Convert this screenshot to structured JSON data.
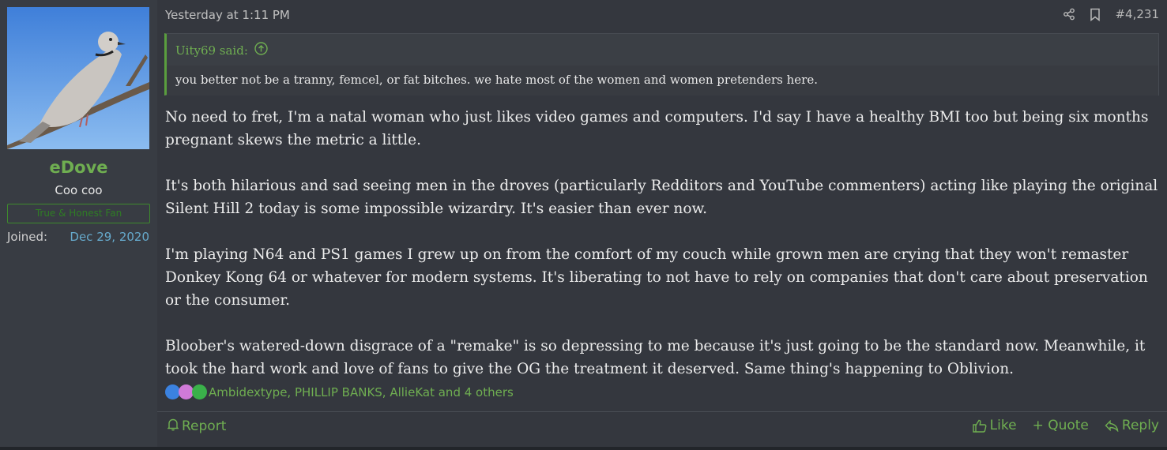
{
  "user": {
    "username": "eDove",
    "user_title": "Coo coo",
    "banner": "True & Honest Fan",
    "joined_label": "Joined:",
    "joined_value": "Dec 29, 2020"
  },
  "post": {
    "date": "Yesterday at 1:11 PM",
    "number": "#4,231",
    "quote": {
      "author": "Uity69 said:",
      "text": "you better not be a tranny, femcel, or fat bitches. we hate most of the women and women pretenders here."
    },
    "paragraphs": [
      "No need to fret, I'm a natal woman who just likes video games and computers. I'd say I have a healthy BMI too but being six months pregnant skews the metric a little.",
      "It's both hilarious and sad seeing men in the droves (particularly Redditors and YouTube commenters) acting like playing the original Silent Hill 2 today is some impossible wizardry. It's easier than ever now.",
      "I'm playing N64 and PS1 games I grew up on from the comfort of my couch while grown men are crying that they won't remaster Donkey Kong 64 or whatever for modern systems. It's liberating to not have to rely on companies that don't care about preservation or the consumer.",
      "Bloober's watered-down disgrace of a \"remake\" is so depressing to me because it's just going to be the standard now. Meanwhile, it took the hard work and love of fans to give the OG the treatment it deserved. Same thing's happening to Oblivion."
    ],
    "reactions_text": "Ambidextype, PHILLIP BANKS, AllieKat and 4 others",
    "actions": {
      "report": "Report",
      "like": "Like",
      "quote": "+ Quote",
      "reply": "Reply"
    }
  },
  "colors": {
    "accent": "#6fae51",
    "link_blue": "#66aacc",
    "post_bg": "#34373e",
    "user_bg": "#383c43"
  }
}
